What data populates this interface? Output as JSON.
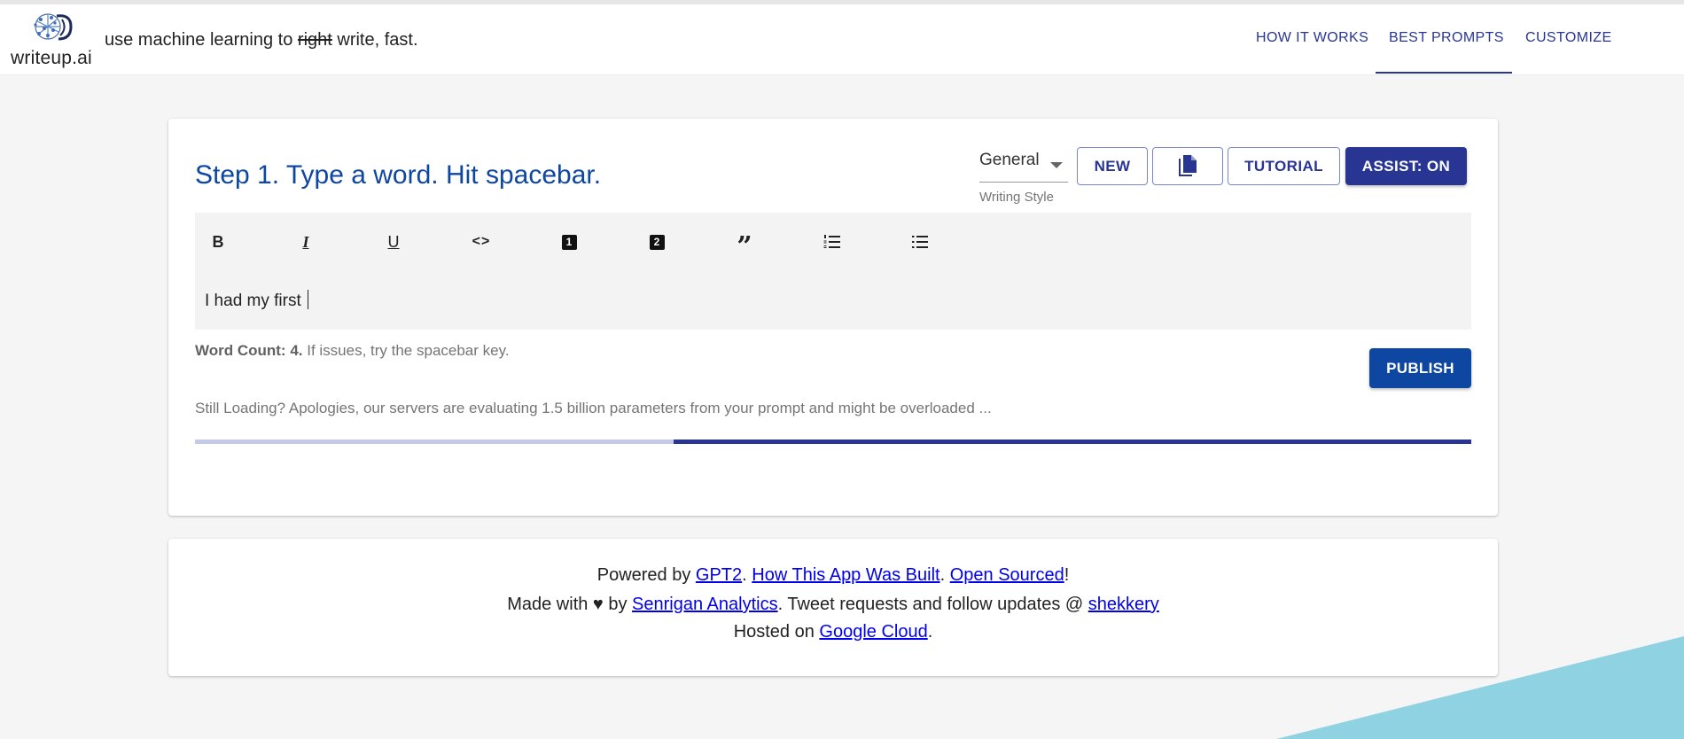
{
  "header": {
    "logo_text": "writeup.ai",
    "tagline_before": "use machine learning to ",
    "tagline_struck": "right",
    "tagline_after": " write, fast.",
    "nav": [
      {
        "label": "HOW IT WORKS"
      },
      {
        "label": "BEST PROMPTS",
        "active": true
      },
      {
        "label": "CUSTOMIZE"
      }
    ]
  },
  "main": {
    "step_title": "Step 1. Type a word. Hit spacebar.",
    "writing_style": {
      "value": "General",
      "helper": "Writing Style"
    },
    "buttons": {
      "new": "NEW",
      "copy_icon": "copy-icon",
      "tutorial": "TUTORIAL",
      "assist": "ASSIST: ON"
    },
    "toolbar": [
      {
        "name": "bold",
        "glyph": "B"
      },
      {
        "name": "italic",
        "glyph": "I"
      },
      {
        "name": "underline",
        "glyph": "U"
      },
      {
        "name": "code",
        "glyph": "<>"
      },
      {
        "name": "heading-one",
        "glyph": "1"
      },
      {
        "name": "heading-two",
        "glyph": "2"
      },
      {
        "name": "quote",
        "glyph": "”"
      },
      {
        "name": "numbered-list",
        "glyph": "ol"
      },
      {
        "name": "bulleted-list",
        "glyph": "ul"
      }
    ],
    "editor_text": "I had my first ",
    "word_count_label": "Word Count: 4.",
    "word_count_hint": " If issues, try the spacebar key.",
    "publish_label": "PUBLISH",
    "loading_text": "Still Loading? Apologies, our servers are evaluating 1.5 billion parameters from your prompt and might be overloaded ...",
    "progress": {
      "buffer_percent": 37.5,
      "value_percent": 100
    }
  },
  "footer": {
    "line1": {
      "pre": "Powered by ",
      "link1": "GPT2",
      "sep1": ". ",
      "link2": "How This App Was Built",
      "sep2": ". ",
      "link3": "Open Sourced",
      "post": "!"
    },
    "line2": {
      "pre": "Made with ♥ by ",
      "link1": "Senrigan Analytics",
      "mid": ". Tweet requests and follow updates @ ",
      "link2": "shekkery"
    },
    "line3": {
      "pre": "Hosted on ",
      "link1": "Google Cloud",
      "post": "."
    }
  },
  "colors": {
    "primary": "#283593",
    "title_blue": "#0d47a1",
    "progress_track": "#c5cae9",
    "triangle": "#8fd3e2"
  }
}
